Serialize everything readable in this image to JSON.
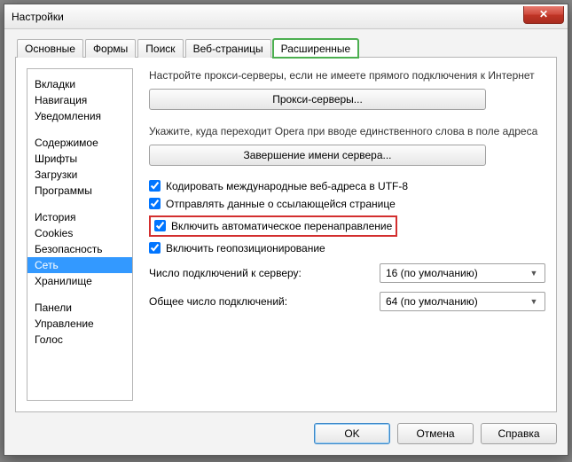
{
  "window": {
    "title": "Настройки"
  },
  "tabs": [
    {
      "label": "Основные"
    },
    {
      "label": "Формы"
    },
    {
      "label": "Поиск"
    },
    {
      "label": "Веб-страницы"
    },
    {
      "label": "Расширенные"
    }
  ],
  "sidebar": {
    "groups": [
      [
        "Вкладки",
        "Навигация",
        "Уведомления"
      ],
      [
        "Содержимое",
        "Шрифты",
        "Загрузки",
        "Программы"
      ],
      [
        "История",
        "Cookies",
        "Безопасность",
        "Сеть",
        "Хранилище"
      ],
      [
        "Панели",
        "Управление",
        "Голос"
      ]
    ],
    "selected": "Сеть"
  },
  "content": {
    "proxy_desc": "Настройте прокси-серверы, если не имеете прямого подключения к Интернет",
    "proxy_btn": "Прокси-серверы...",
    "server_desc": "Укажите, куда переходит Opera при вводе единственного слова в поле адреса",
    "server_btn": "Завершение имени сервера...",
    "cb_utf8": "Кодировать международные веб-адреса в UTF-8",
    "cb_referer": "Отправлять данные о ссылающейся странице",
    "cb_redirect": "Включить автоматическое перенаправление",
    "cb_geo": "Включить геопозиционирование",
    "conn_server_label": "Число подключений к серверу:",
    "conn_server_value": "16 (по умолчанию)",
    "conn_total_label": "Общее число подключений:",
    "conn_total_value": "64 (по умолчанию)"
  },
  "footer": {
    "ok": "OK",
    "cancel": "Отмена",
    "help": "Справка"
  }
}
